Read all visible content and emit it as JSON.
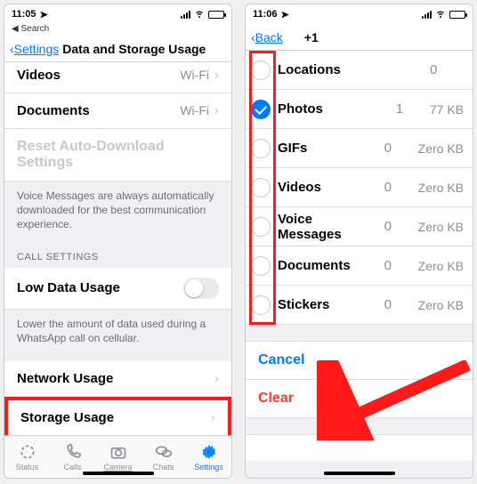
{
  "left": {
    "status": {
      "time": "11:05",
      "back_search": "Search"
    },
    "nav": {
      "back": "Settings",
      "title": "Data and Storage Usage"
    },
    "rows": {
      "videos": {
        "label": "Videos",
        "value": "Wi-Fi"
      },
      "documents": {
        "label": "Documents",
        "value": "Wi-Fi"
      }
    },
    "reset": "Reset Auto-Download Settings",
    "voice_note": "Voice Messages are always automatically downloaded for the best communication experience.",
    "call_header": "CALL SETTINGS",
    "low_data": {
      "label": "Low Data Usage"
    },
    "low_data_note": "Lower the amount of data used during a WhatsApp call on cellular.",
    "network": {
      "label": "Network Usage"
    },
    "storage": {
      "label": "Storage Usage"
    },
    "tabs": {
      "status": "Status",
      "calls": "Calls",
      "camera": "Camera",
      "chats": "Chats",
      "settings": "Settings"
    }
  },
  "right": {
    "status": {
      "time": "11:06"
    },
    "nav": {
      "back": "Back",
      "title": "+1"
    },
    "items": [
      {
        "label": "Locations",
        "count": "0",
        "size": "",
        "checked": false
      },
      {
        "label": "Photos",
        "count": "1",
        "size": "77 KB",
        "checked": true
      },
      {
        "label": "GIFs",
        "count": "0",
        "size": "Zero KB",
        "checked": false
      },
      {
        "label": "Videos",
        "count": "0",
        "size": "Zero KB",
        "checked": false
      },
      {
        "label": "Voice Messages",
        "count": "0",
        "size": "Zero KB",
        "checked": false
      },
      {
        "label": "Documents",
        "count": "0",
        "size": "Zero KB",
        "checked": false
      },
      {
        "label": "Stickers",
        "count": "0",
        "size": "Zero KB",
        "checked": false
      }
    ],
    "cancel": "Cancel",
    "clear": "Clear"
  }
}
